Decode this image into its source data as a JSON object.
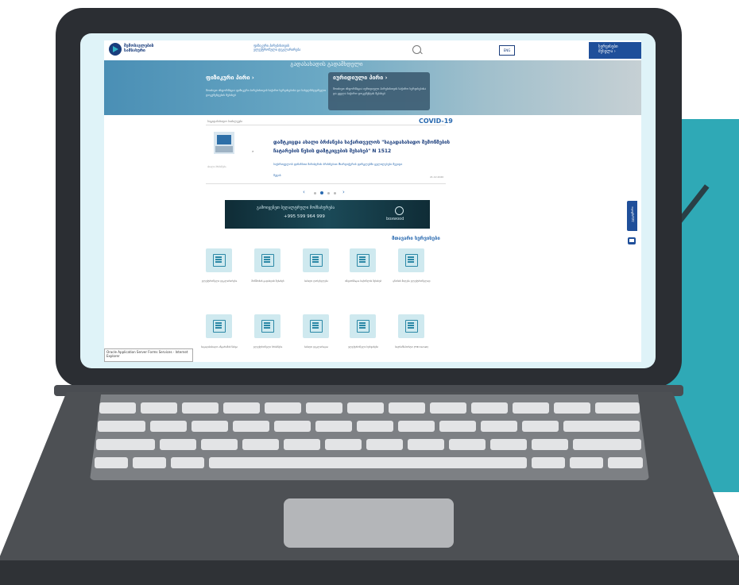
{
  "colors": {
    "teal": "#2fa9b6",
    "laptop": "#2b2e33",
    "brand_blue": "#1a3d7c",
    "link_blue": "#2a6ab0"
  },
  "header": {
    "logo_line1": "შემოსავლების",
    "logo_line2": "სამსახური",
    "top_link1": "ფიზიკური პირებისთვის",
    "top_link2": "ელექტრონული დეკლარირება",
    "language": "ENG",
    "services_line1": "სერვისები",
    "services_line2": "შესვლა ›"
  },
  "banner": {
    "title": "გადასახადის გადამხდელი",
    "tab1_title": "ფიზიკური პირი ›",
    "tab1_desc": "მოიძიეთ ინფორმაცია ფიზიკური პირებისთვის საჭირო სერვისებისა და სახელმძღვანელო დოკუმენტების შესახებ",
    "tab2_title": "იურიდიული პირი ›",
    "tab2_desc": "მოიძიეთ ინფორმაცია იურიდიული პირებისთვის საჭირო სერვისებისა და ყველა საჭირო დოკუმენტის შესახებ"
  },
  "news": {
    "section_label": "საგადასახადო სიახლეები",
    "covid": "COVID-19",
    "title": "დამტკიცდა ახალი ბრძანება საქართველოს \"საგადასახადო შემოწმების ჩატარების წესის დამტკიცების შესახებ\" N 1512",
    "text": "საქართველოს ფინანსთა მინისტრის ბრძანებით მხარდაჭერის ფარგლებში ცვლილებები შევიდა",
    "more": "მეტის",
    "date": "21.12.2020",
    "caption": "ახალი ბრძანება",
    "arrow": "»",
    "prev": "‹",
    "next": "›"
  },
  "ad": {
    "text": "გამოიყენეთ ბუღალტრული მომსახურება",
    "phone": "+995 599 964 999",
    "brand": "boxwood"
  },
  "main_services_title": "მთავარი სერვისები",
  "services": [
    {
      "label": "ელექტრონული დეკლარირება"
    },
    {
      "label": "მოწმობის გადახდის შესახებ"
    },
    {
      "label": "საბაჟო ღირებულება"
    },
    {
      "label": "ინფორმაცია საქონლის შესახებ"
    },
    {
      "label": "ცნობის მიღება ელექტრონულად"
    },
    {
      "label": "საგადასახადო ანგარიშის ნახვა"
    },
    {
      "label": "ელექტრონული ბრძანება"
    },
    {
      "label": "საბაჟო დეკლარაცია"
    },
    {
      "label": "ელექტრონული სერვისები"
    },
    {
      "label": "სატრანსპორტო (TIR Carnet)"
    }
  ],
  "feedback": "უკუკავშირი",
  "tooltip": "Oracle Application Server Forms Services - Internet Explorer"
}
